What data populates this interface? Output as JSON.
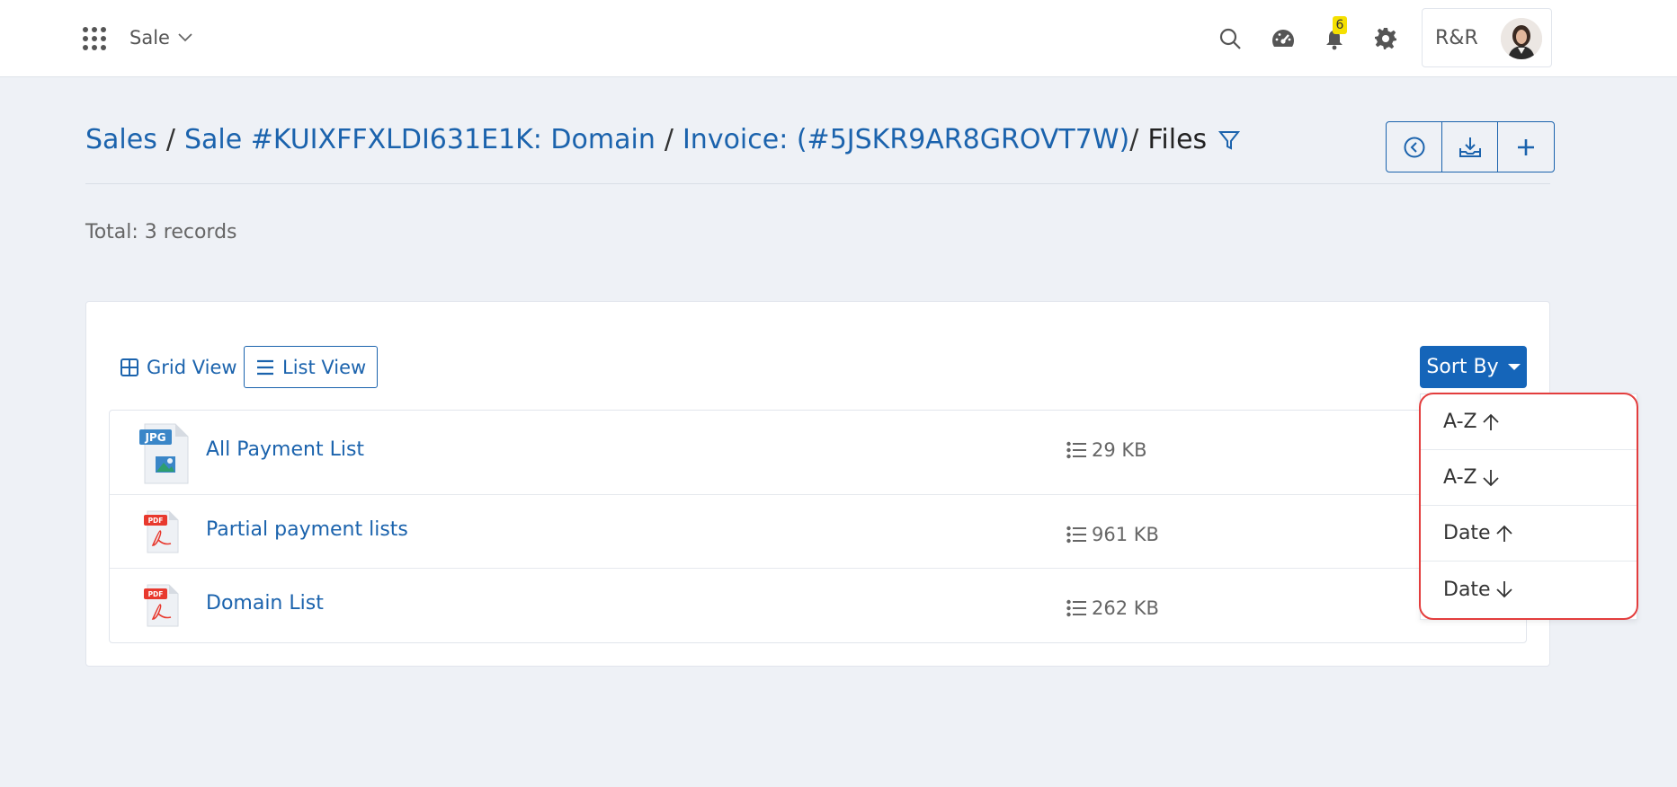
{
  "topbar": {
    "module_label": "Sale",
    "notification_count": "6",
    "user_label": "R&R"
  },
  "breadcrumb": {
    "items": [
      "Sales",
      "Sale #KUIXFFXLDI631E1K: Domain",
      "Invoice: (#5JSKR9AR8GROVT7W)"
    ],
    "current": "Files"
  },
  "summary": {
    "total": "Total: 3 records"
  },
  "view_toggle": {
    "grid_label": "Grid View",
    "list_label": "List View"
  },
  "sort": {
    "button_label": "Sort By",
    "options": [
      "A-Z",
      "A-Z",
      "Date",
      "Date"
    ],
    "option_directions": [
      "up",
      "down",
      "up",
      "down"
    ]
  },
  "files": [
    {
      "name": "All Payment List",
      "size": "29 KB",
      "type": "JPG"
    },
    {
      "name": "Partial payment lists",
      "size": "961 KB",
      "type": "PDF"
    },
    {
      "name": "Domain List",
      "size": "262 KB",
      "type": "PDF"
    }
  ],
  "colors": {
    "accent": "#1b63ad",
    "primary_button": "#1565b9",
    "highlight": "#e33d3d",
    "badge": "#f5e000",
    "pdf_red": "#e8392e",
    "jpg_blue": "#3a86c8"
  }
}
